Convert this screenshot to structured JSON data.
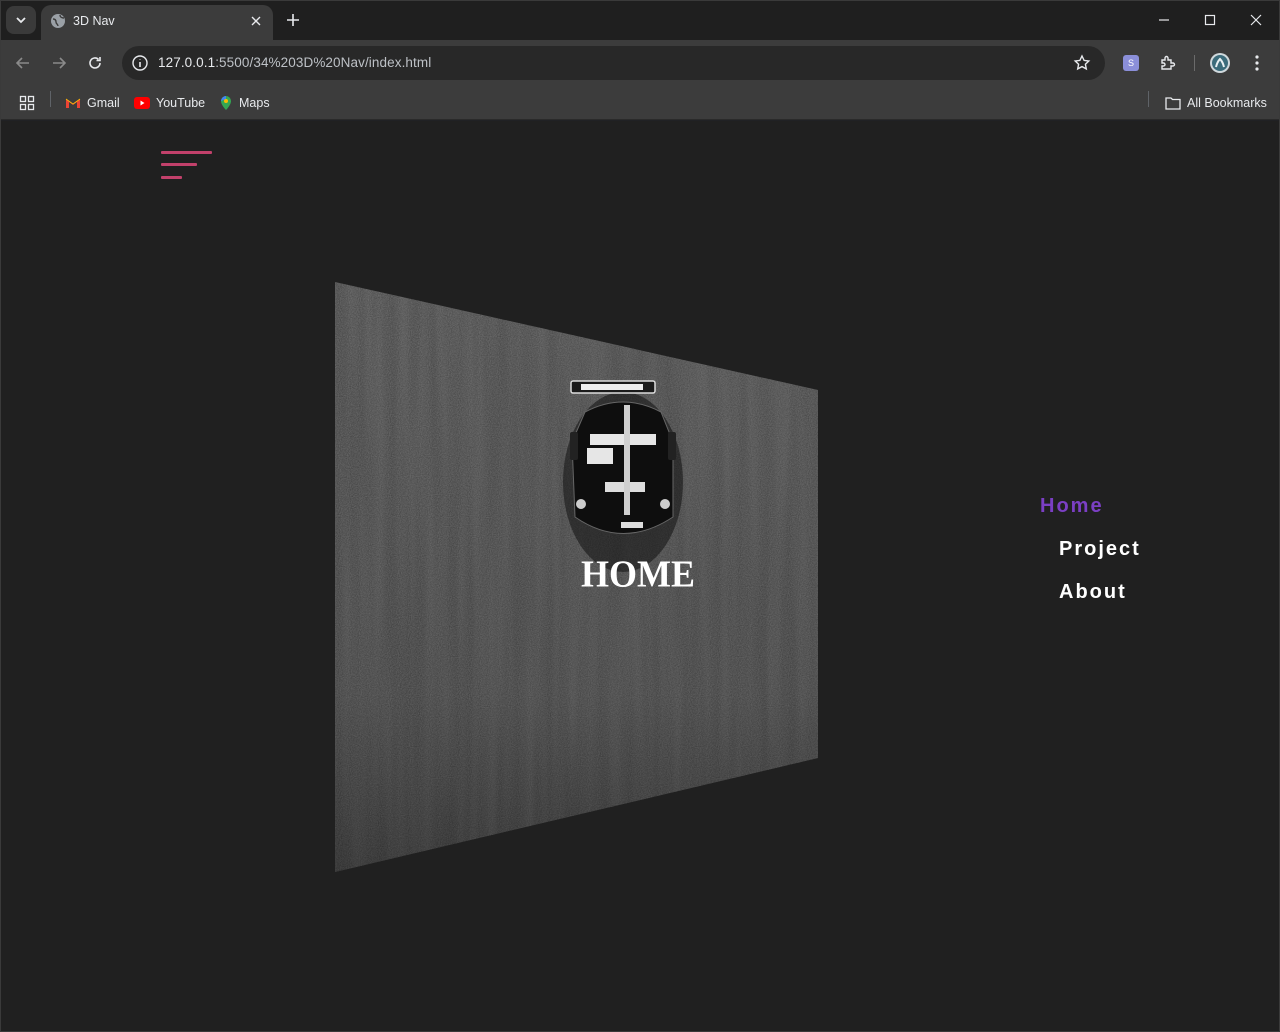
{
  "browser": {
    "tab_title": "3D Nav",
    "url_host": "127.0.0.1",
    "url_rest": ":5500/34%203D%20Nav/index.html",
    "bookmarks": [
      {
        "label": "Gmail",
        "icon": "gmail-icon"
      },
      {
        "label": "YouTube",
        "icon": "youtube-icon"
      },
      {
        "label": "Maps",
        "icon": "maps-icon"
      }
    ],
    "all_bookmarks_label": "All Bookmarks",
    "extension_label": "S"
  },
  "page": {
    "card_title": "HOME",
    "menu": [
      {
        "label": "Home",
        "active": true
      },
      {
        "label": "Project",
        "active": false
      },
      {
        "label": "About",
        "active": false
      }
    ],
    "colors": {
      "background": "#202020",
      "hamburger": "#c2416b",
      "active_menu": "#7b3fc4",
      "menu": "#ffffff"
    }
  }
}
